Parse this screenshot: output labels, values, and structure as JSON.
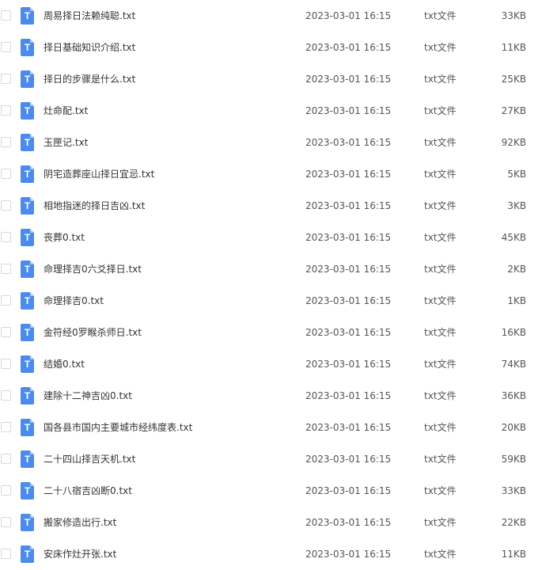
{
  "file_icon_glyph": "T",
  "file_icon_name": "text-file-icon",
  "accent_color": "#4a8bf0",
  "files": [
    {
      "name": "周易择日法赖纯聪.txt",
      "modified": "2023-03-01 16:15",
      "type": "txt文件",
      "size": "33KB"
    },
    {
      "name": "择日基础知识介绍.txt",
      "modified": "2023-03-01 16:15",
      "type": "txt文件",
      "size": "11KB"
    },
    {
      "name": "择日的步骤是什么.txt",
      "modified": "2023-03-01 16:15",
      "type": "txt文件",
      "size": "25KB"
    },
    {
      "name": "灶命配.txt",
      "modified": "2023-03-01 16:15",
      "type": "txt文件",
      "size": "27KB"
    },
    {
      "name": "玉匣记.txt",
      "modified": "2023-03-01 16:15",
      "type": "txt文件",
      "size": "92KB"
    },
    {
      "name": "阴宅造葬座山择日宜忌.txt",
      "modified": "2023-03-01 16:15",
      "type": "txt文件",
      "size": "5KB"
    },
    {
      "name": "相地指迷的择日吉凶.txt",
      "modified": "2023-03-01 16:15",
      "type": "txt文件",
      "size": "3KB"
    },
    {
      "name": "丧葬0.txt",
      "modified": "2023-03-01 16:15",
      "type": "txt文件",
      "size": "45KB"
    },
    {
      "name": "命理择吉0六爻择日.txt",
      "modified": "2023-03-01 16:15",
      "type": "txt文件",
      "size": "2KB"
    },
    {
      "name": "命理择吉0.txt",
      "modified": "2023-03-01 16:15",
      "type": "txt文件",
      "size": "1KB"
    },
    {
      "name": "金符经0罗睺杀师日.txt",
      "modified": "2023-03-01 16:15",
      "type": "txt文件",
      "size": "16KB"
    },
    {
      "name": "结婚0.txt",
      "modified": "2023-03-01 16:15",
      "type": "txt文件",
      "size": "74KB"
    },
    {
      "name": "建除十二神吉凶0.txt",
      "modified": "2023-03-01 16:15",
      "type": "txt文件",
      "size": "36KB"
    },
    {
      "name": "国各县市国内主要城市经纬度表.txt",
      "modified": "2023-03-01 16:15",
      "type": "txt文件",
      "size": "20KB"
    },
    {
      "name": "二十四山择吉天机.txt",
      "modified": "2023-03-01 16:15",
      "type": "txt文件",
      "size": "59KB"
    },
    {
      "name": "二十八宿吉凶断0.txt",
      "modified": "2023-03-01 16:15",
      "type": "txt文件",
      "size": "33KB"
    },
    {
      "name": "搬家修造出行.txt",
      "modified": "2023-03-01 16:15",
      "type": "txt文件",
      "size": "22KB"
    },
    {
      "name": "安床作灶开张.txt",
      "modified": "2023-03-01 16:15",
      "type": "txt文件",
      "size": "11KB"
    }
  ]
}
